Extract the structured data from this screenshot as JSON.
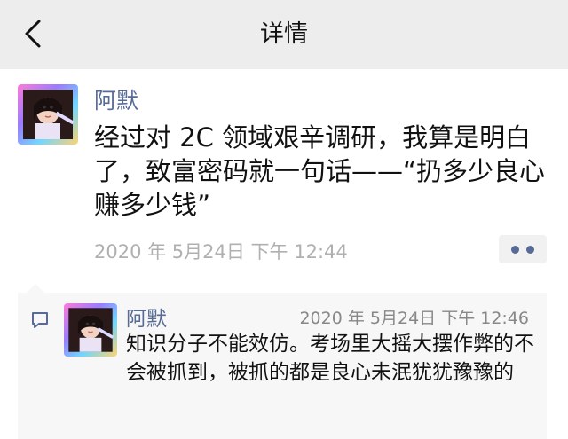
{
  "header": {
    "title": "详情",
    "back_icon": "chevron-left-icon"
  },
  "post": {
    "author": "阿默",
    "text": "经过对 2C 领域艰辛调研，我算是明白了，致富密码就一句话——“扔多少良心赚多少钱”",
    "time": "2020 年 5月24日 下午 12:44",
    "more_icon": "more-dots-icon"
  },
  "comment": {
    "icon": "comment-icon",
    "author": "阿默",
    "time": "2020 年 5月24日 下午 12:46",
    "text": "知识分子不能效仿。考场里大摇大摆作弊的不会被抓到，被抓的都是良心未泯犹犹豫豫的"
  },
  "colors": {
    "link": "#576b95",
    "header_bg": "#ededed",
    "comment_bg": "#f7f7f7"
  }
}
